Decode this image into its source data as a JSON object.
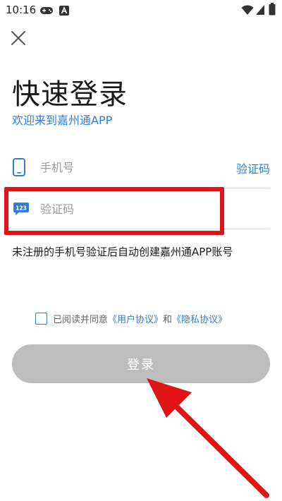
{
  "status_bar": {
    "time": "10:16"
  },
  "header": {
    "title": "快速登录",
    "subtitle": "欢迎来到嘉州通APP"
  },
  "form": {
    "phone_placeholder": "手机号",
    "get_code_label": "验证码",
    "code_placeholder": "验证码"
  },
  "notice": "未注册的手机号验证后自动创建嘉州通APP账号",
  "agreement": {
    "prefix": "已阅读并同意",
    "user_agreement": "《用户协议》",
    "and": "和",
    "privacy_policy": "《隐私协议》"
  },
  "login_button": "登录",
  "code_icon_text": "123",
  "colors": {
    "accent": "#2f7fd6",
    "button_disabled": "#bdbdbd",
    "annotation_red": "#e01414"
  }
}
